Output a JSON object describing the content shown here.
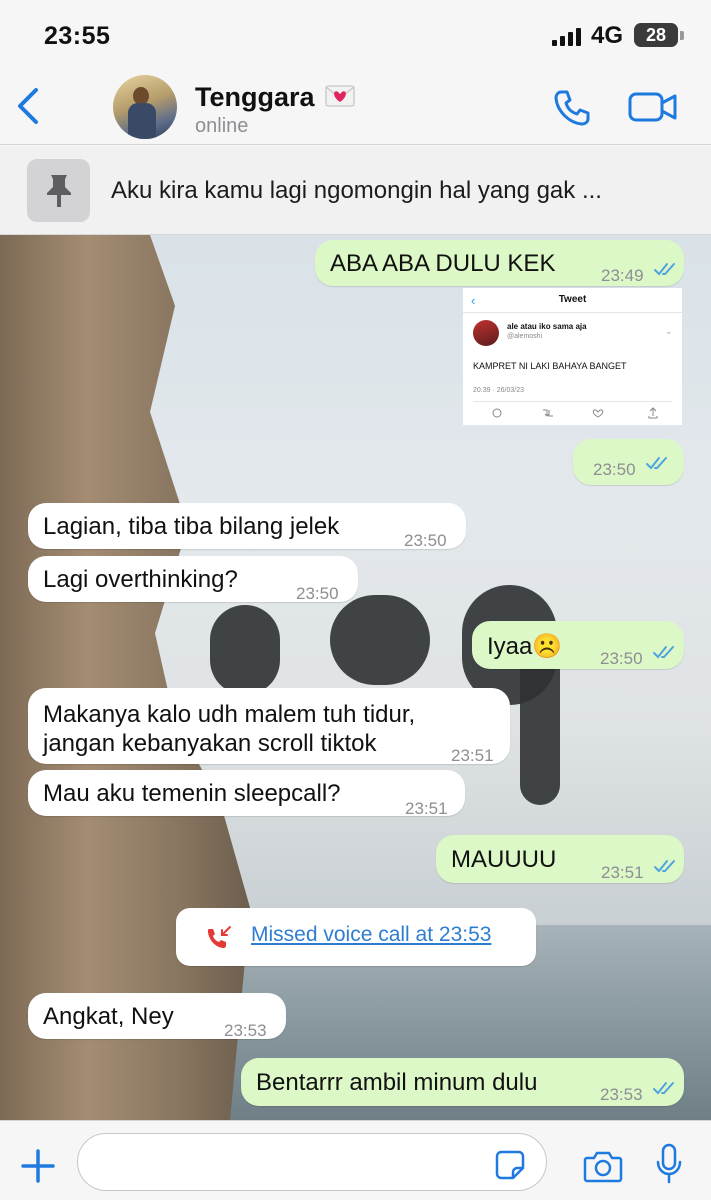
{
  "status_bar": {
    "time": "23:55",
    "network": "4G",
    "battery": "28"
  },
  "header": {
    "contact_name": "Tenggara",
    "contact_status": "online",
    "icons": {
      "back": "chevron-left-icon",
      "heart": "heart-letter-icon",
      "phone": "phone-icon",
      "video": "video-camera-icon"
    }
  },
  "pinned": {
    "text": "Aku kira kamu lagi ngomongin hal yang gak ...",
    "icon": "pin-icon"
  },
  "messages": [
    {
      "dir": "out",
      "text": "ABA ABA DULU KEK",
      "time": "23:49",
      "status": "read"
    },
    {
      "dir": "out",
      "type": "image",
      "time": "23:50",
      "status": "read"
    },
    {
      "dir": "in",
      "text": "Lagian, tiba tiba bilang jelek",
      "time": "23:50"
    },
    {
      "dir": "in",
      "text": "Lagi overthinking?",
      "time": "23:50"
    },
    {
      "dir": "out",
      "text": "Iyaa☹️",
      "time": "23:50",
      "status": "read"
    },
    {
      "dir": "in",
      "text_line1": "Makanya kalo udh malem tuh tidur,",
      "text_line2": "jangan kebanyakan scroll tiktok",
      "time": "23:51"
    },
    {
      "dir": "in",
      "text": "Mau aku temenin sleepcall?",
      "time": "23:51"
    },
    {
      "dir": "out",
      "text": "MAUUUU",
      "time": "23:51",
      "status": "read"
    },
    {
      "dir": "in",
      "text": "Angkat, Ney",
      "time": "23:53"
    },
    {
      "dir": "out",
      "text": "Bentarrr ambil minum dulu",
      "time": "23:53",
      "status": "read"
    }
  ],
  "missed_call": {
    "label": "Missed voice call at 23:53",
    "icon": "missed-call-icon"
  },
  "tweet": {
    "title": "Tweet",
    "name": "ale atau iko sama aja",
    "handle": "@alemoshi",
    "text": "KAMPRET NI LAKI BAHAYA BANGET",
    "date": "20.39 · 26/03/23"
  },
  "composer": {
    "placeholder": "",
    "value": ""
  },
  "colors": {
    "accent": "#1f7ae0",
    "outgoing_bubble": "#dcf8c6",
    "incoming_bubble": "#ffffff",
    "read_ticks": "#4fa3e0"
  }
}
